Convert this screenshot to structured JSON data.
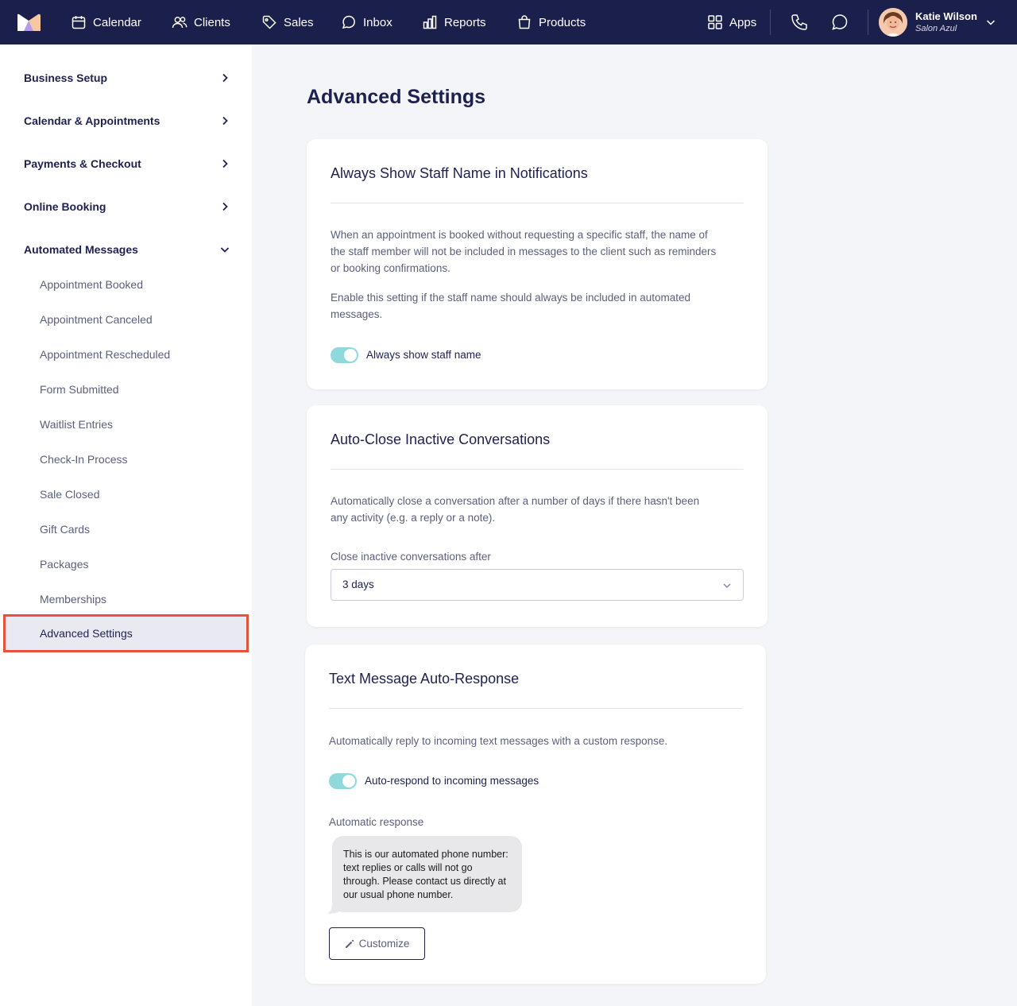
{
  "nav": {
    "items": [
      {
        "label": "Calendar",
        "icon": "calendar-icon"
      },
      {
        "label": "Clients",
        "icon": "users-icon"
      },
      {
        "label": "Sales",
        "icon": "tag-icon"
      },
      {
        "label": "Inbox",
        "icon": "inbox-icon"
      },
      {
        "label": "Reports",
        "icon": "bar-chart-icon"
      },
      {
        "label": "Products",
        "icon": "shopping-bag-icon"
      }
    ],
    "apps_label": "Apps",
    "user": {
      "name": "Katie Wilson",
      "org": "Salon Azul"
    }
  },
  "sidebar": {
    "sections": [
      {
        "label": "Business Setup",
        "state": "collapsed"
      },
      {
        "label": "Calendar & Appointments",
        "state": "collapsed"
      },
      {
        "label": "Payments & Checkout",
        "state": "collapsed"
      },
      {
        "label": "Online Booking",
        "state": "collapsed"
      },
      {
        "label": "Automated Messages",
        "state": "expanded"
      }
    ],
    "sub_items": [
      "Appointment Booked",
      "Appointment Canceled",
      "Appointment Rescheduled",
      "Form Submitted",
      "Waitlist Entries",
      "Check-In Process",
      "Sale Closed",
      "Gift Cards",
      "Packages",
      "Memberships"
    ],
    "active_item": "Advanced Settings"
  },
  "page": {
    "title": "Advanced Settings"
  },
  "cards": {
    "staff_name": {
      "title": "Always Show Staff Name in Notifications",
      "text1": "When an appointment is booked without requesting a specific staff, the name of the staff member will not be included in messages to the client such as reminders or booking confirmations.",
      "text2": "Enable this setting if the staff name should always be included in automated messages.",
      "toggle_label": "Always show staff name",
      "toggle_on": true
    },
    "auto_close": {
      "title": "Auto-Close Inactive Conversations",
      "text": "Automatically close a conversation after a number of days if there hasn't been any activity (e.g. a reply or a note).",
      "field_label": "Close inactive conversations after",
      "select_value": "3 days"
    },
    "auto_response": {
      "title": "Text Message Auto-Response",
      "text": "Automatically reply to incoming text messages with a custom response.",
      "toggle_label": "Auto-respond to incoming messages",
      "toggle_on": true,
      "field_label": "Automatic response",
      "message": "This is our automated phone number: text replies or calls will not go through. Please contact us directly at our usual phone number.",
      "button_label": "Customize"
    }
  },
  "colors": {
    "nav_bg": "#1b1f4b",
    "toggle_on": "#8fd8dc",
    "highlight_border": "#e5533d"
  }
}
